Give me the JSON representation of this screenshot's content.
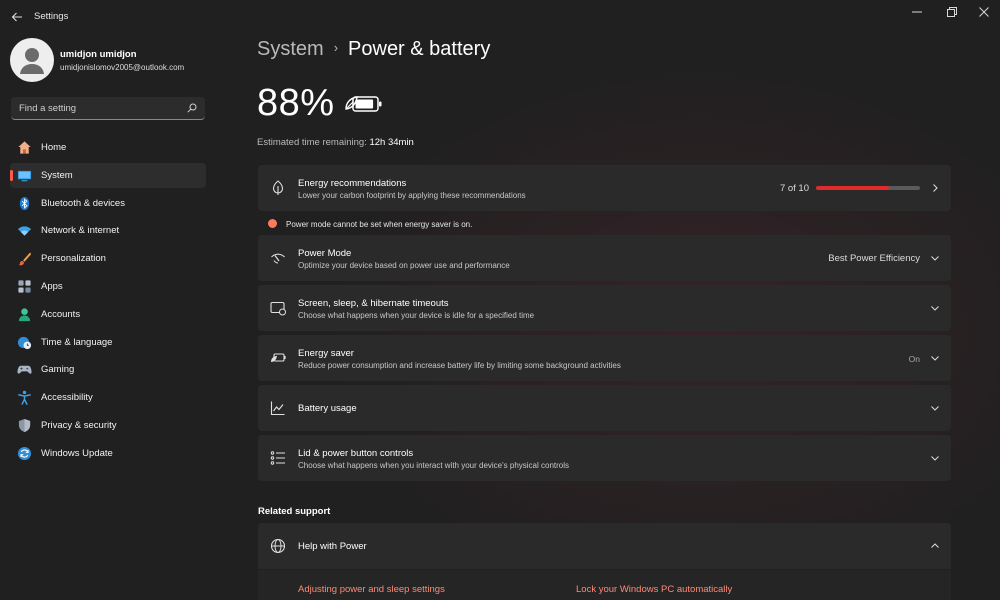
{
  "app": {
    "title": "Settings"
  },
  "profile": {
    "name": "umidjon umidjon",
    "email": "umidjonislomov2005@outlook.com"
  },
  "search": {
    "placeholder": "Find a setting"
  },
  "sidebar": {
    "items": [
      {
        "label": "Home",
        "icon": "home-icon"
      },
      {
        "label": "System",
        "icon": "system-icon",
        "active": true
      },
      {
        "label": "Bluetooth & devices",
        "icon": "bluetooth-icon"
      },
      {
        "label": "Network & internet",
        "icon": "wifi-icon"
      },
      {
        "label": "Personalization",
        "icon": "brush-icon"
      },
      {
        "label": "Apps",
        "icon": "apps-icon"
      },
      {
        "label": "Accounts",
        "icon": "accounts-icon"
      },
      {
        "label": "Time & language",
        "icon": "globe-clock-icon"
      },
      {
        "label": "Gaming",
        "icon": "gamepad-icon"
      },
      {
        "label": "Accessibility",
        "icon": "accessibility-icon"
      },
      {
        "label": "Privacy & security",
        "icon": "shield-icon"
      },
      {
        "label": "Windows Update",
        "icon": "update-icon"
      }
    ]
  },
  "header": {
    "root": "System",
    "current": "Power & battery"
  },
  "battery": {
    "percent": "88%",
    "level": 0.88,
    "estimate_label": "Estimated time remaining:",
    "estimate_value": "12h 34min"
  },
  "energy_recommendations": {
    "title": "Energy recommendations",
    "subtitle": "Lower your carbon footprint by applying these recommendations",
    "progress_text": "7 of 10",
    "progress_fraction": 0.7
  },
  "warning": {
    "text": "Power mode cannot be set when energy saver is on."
  },
  "power_mode": {
    "title": "Power Mode",
    "subtitle": "Optimize your device based on power use and performance",
    "value": "Best Power Efficiency"
  },
  "timeouts": {
    "title": "Screen, sleep, & hibernate timeouts",
    "subtitle": "Choose what happens when your device is idle for a specified time"
  },
  "energy_saver": {
    "title": "Energy saver",
    "subtitle": "Reduce power consumption and increase battery life by limiting some background activities",
    "value": "On"
  },
  "battery_usage": {
    "title": "Battery usage"
  },
  "lid": {
    "title": "Lid & power button controls",
    "subtitle": "Choose what happens when you interact with your device's physical controls"
  },
  "related_support": {
    "heading": "Related support",
    "help_title": "Help with Power",
    "links": [
      "Adjusting power and sleep settings",
      "Lock your Windows PC automatically"
    ]
  },
  "colors": {
    "accent": "#ff5c4d",
    "progress": "#e12a2a",
    "link": "#ff8a75",
    "background": "#202020",
    "card": "#2b2a2b"
  }
}
